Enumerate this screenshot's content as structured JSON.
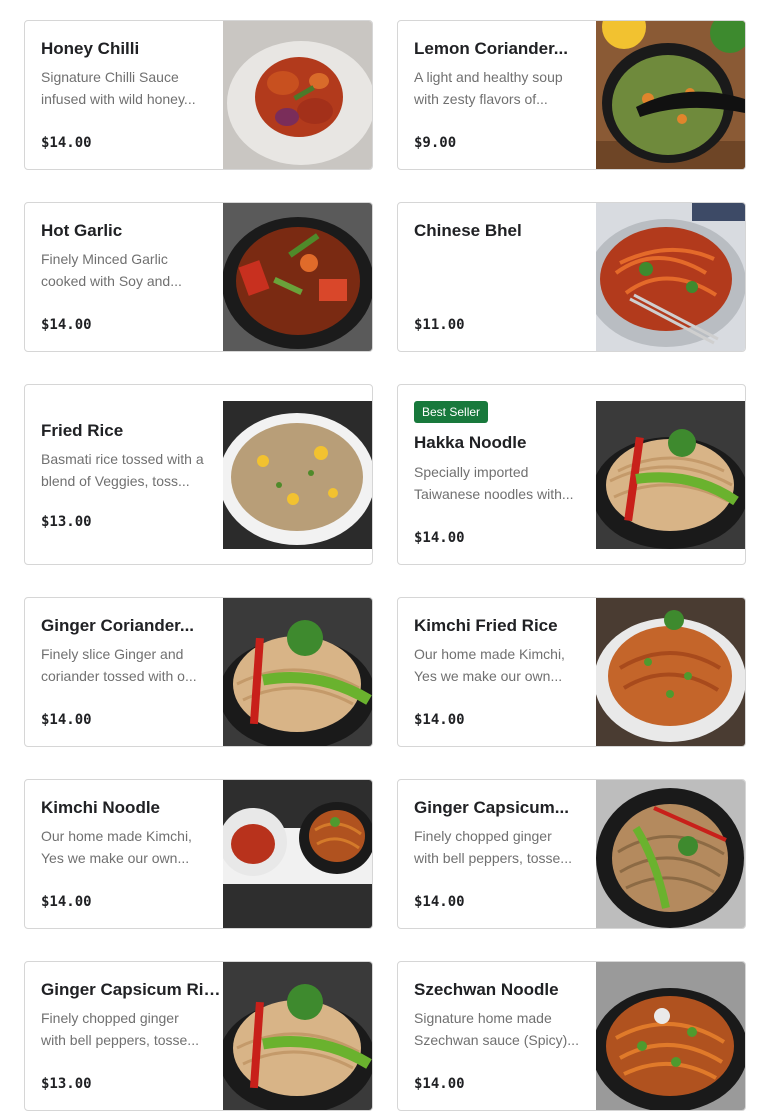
{
  "menu": {
    "items": [
      {
        "name": "Honey Chilli",
        "description": "Signature Chilli Sauce infused with wild honey...",
        "price": "$14.00",
        "image": "honey-chilli-photo"
      },
      {
        "name": "Lemon Coriander...",
        "description": "A light and healthy soup with zesty flavors of...",
        "price": "$9.00",
        "image": "lemon-coriander-soup-photo"
      },
      {
        "name": "Hot Garlic",
        "description": "Finely Minced Garlic cooked with Soy and...",
        "price": "$14.00",
        "image": "hot-garlic-photo"
      },
      {
        "name": "Chinese Bhel",
        "description": "",
        "price": "$11.00",
        "image": "chinese-bhel-photo"
      },
      {
        "name": "Fried Rice",
        "description": "Basmati rice tossed with a blend of Veggies, toss...",
        "price": "$13.00",
        "image": "fried-rice-photo"
      },
      {
        "name": "Hakka Noodle",
        "description": "Specially imported Taiwanese noodles with...",
        "price": "$14.00",
        "badge": "Best Seller",
        "image": "hakka-noodle-photo"
      },
      {
        "name": "Ginger Coriander...",
        "description": "Finely slice Ginger and coriander tossed with o...",
        "price": "$14.00",
        "image": "ginger-coriander-noodle-photo"
      },
      {
        "name": "Kimchi Fried Rice",
        "description": "Our home made Kimchi, Yes we make our own...",
        "price": "$14.00",
        "image": "kimchi-fried-rice-photo"
      },
      {
        "name": "Kimchi Noodle",
        "description": "Our home made Kimchi, Yes we make our own...",
        "price": "$14.00",
        "image": "kimchi-noodle-photo"
      },
      {
        "name": "Ginger Capsicum...",
        "description": "Finely chopped ginger with bell peppers, tosse...",
        "price": "$14.00",
        "image": "ginger-capsicum-noodle-photo"
      },
      {
        "name": "Ginger Capsicum Rice",
        "description": "Finely chopped ginger with bell peppers, tosse...",
        "price": "$13.00",
        "image": "ginger-capsicum-rice-photo"
      },
      {
        "name": "Szechwan Noodle",
        "description": "Signature home made Szechwan sauce (Spicy)...",
        "price": "$14.00",
        "image": "szechwan-noodle-photo"
      }
    ]
  },
  "colors": {
    "badge_background": "#18793c",
    "card_border": "#d6d6d6",
    "description_text": "#707070"
  }
}
